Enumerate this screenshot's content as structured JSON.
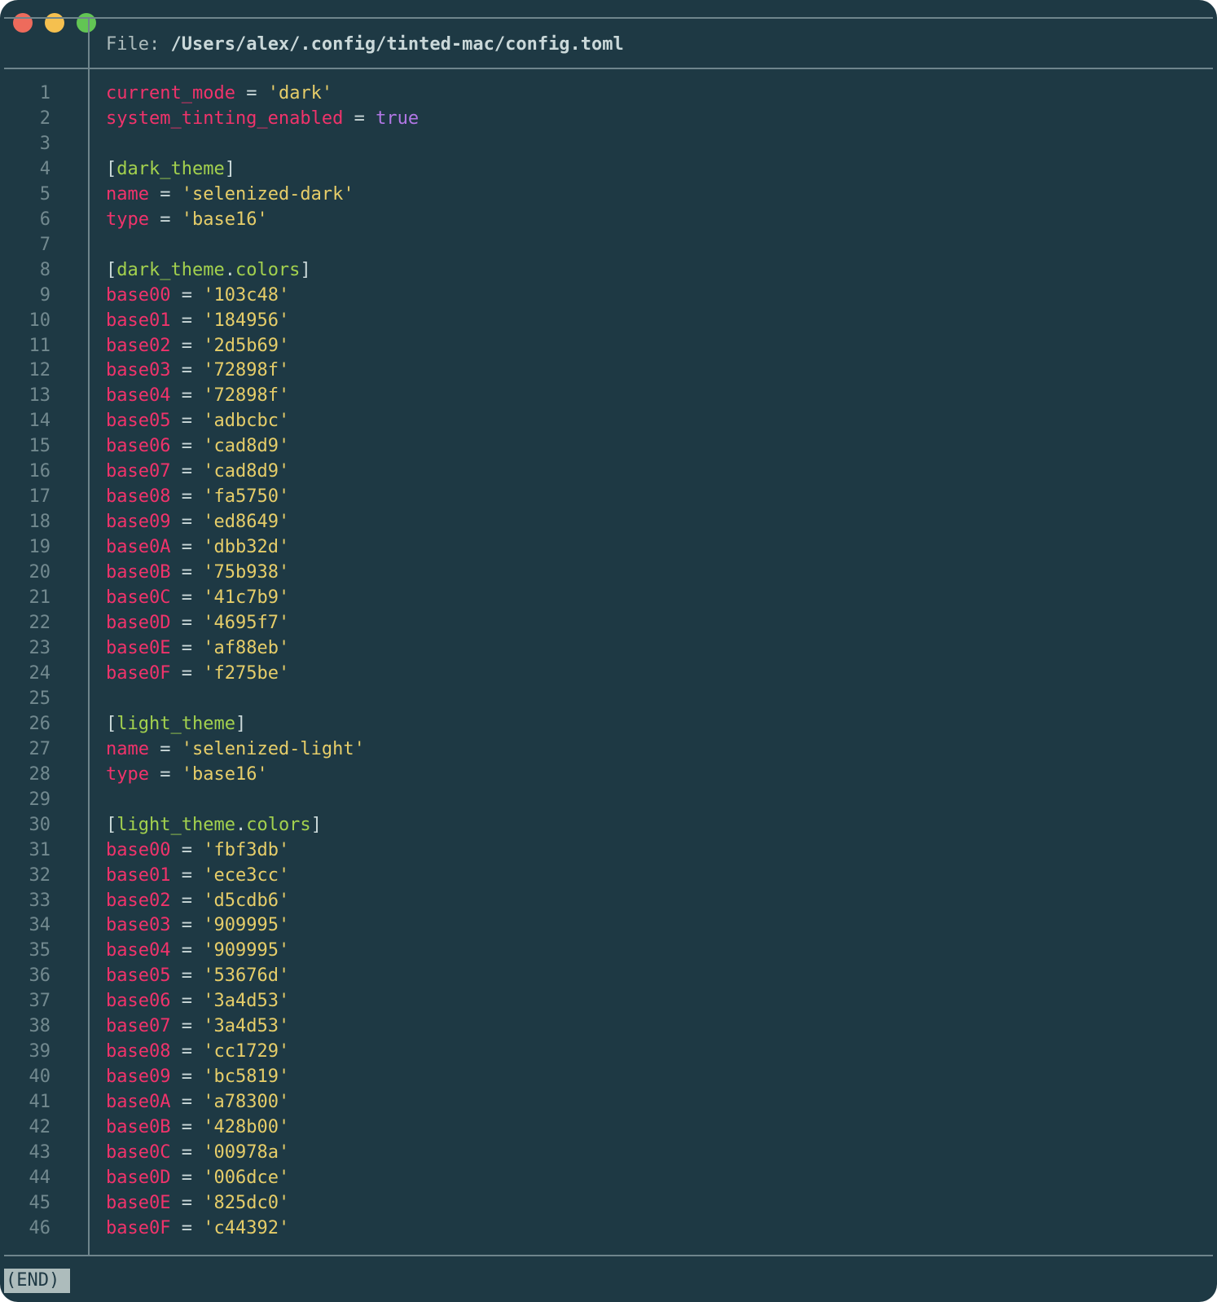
{
  "window": {
    "traffic_lights": [
      {
        "name": "close",
        "color": "#ee6b5c"
      },
      {
        "name": "minimize",
        "color": "#f5c04f"
      },
      {
        "name": "maximize",
        "color": "#62c554"
      }
    ]
  },
  "header": {
    "label": "File: ",
    "path": "/Users/alex/.config/tinted-mac/config.toml"
  },
  "colors": {
    "background": "#1e3944",
    "key": "#f0336b",
    "string": "#e6cd69",
    "table_name": "#a3d14e",
    "boolean": "#b277e6",
    "line_number": "#72898f",
    "rule": "#6f858c"
  },
  "lines": [
    {
      "n": "1",
      "kind": "kv",
      "key": "current_mode",
      "value": "'dark'"
    },
    {
      "n": "2",
      "kind": "kvbool",
      "key": "system_tinting_enabled",
      "value": "true"
    },
    {
      "n": "3",
      "kind": "blank"
    },
    {
      "n": "4",
      "kind": "table",
      "parts": [
        "dark_theme"
      ]
    },
    {
      "n": "5",
      "kind": "kv",
      "key": "name",
      "value": "'selenized-dark'"
    },
    {
      "n": "6",
      "kind": "kv",
      "key": "type",
      "value": "'base16'"
    },
    {
      "n": "7",
      "kind": "blank"
    },
    {
      "n": "8",
      "kind": "table",
      "parts": [
        "dark_theme",
        "colors"
      ]
    },
    {
      "n": "9",
      "kind": "kv",
      "key": "base00",
      "value": "'103c48'"
    },
    {
      "n": "10",
      "kind": "kv",
      "key": "base01",
      "value": "'184956'"
    },
    {
      "n": "11",
      "kind": "kv",
      "key": "base02",
      "value": "'2d5b69'"
    },
    {
      "n": "12",
      "kind": "kv",
      "key": "base03",
      "value": "'72898f'"
    },
    {
      "n": "13",
      "kind": "kv",
      "key": "base04",
      "value": "'72898f'"
    },
    {
      "n": "14",
      "kind": "kv",
      "key": "base05",
      "value": "'adbcbc'"
    },
    {
      "n": "15",
      "kind": "kv",
      "key": "base06",
      "value": "'cad8d9'"
    },
    {
      "n": "16",
      "kind": "kv",
      "key": "base07",
      "value": "'cad8d9'"
    },
    {
      "n": "17",
      "kind": "kv",
      "key": "base08",
      "value": "'fa5750'"
    },
    {
      "n": "18",
      "kind": "kv",
      "key": "base09",
      "value": "'ed8649'"
    },
    {
      "n": "19",
      "kind": "kv",
      "key": "base0A",
      "value": "'dbb32d'"
    },
    {
      "n": "20",
      "kind": "kv",
      "key": "base0B",
      "value": "'75b938'"
    },
    {
      "n": "21",
      "kind": "kv",
      "key": "base0C",
      "value": "'41c7b9'"
    },
    {
      "n": "22",
      "kind": "kv",
      "key": "base0D",
      "value": "'4695f7'"
    },
    {
      "n": "23",
      "kind": "kv",
      "key": "base0E",
      "value": "'af88eb'"
    },
    {
      "n": "24",
      "kind": "kv",
      "key": "base0F",
      "value": "'f275be'"
    },
    {
      "n": "25",
      "kind": "blank"
    },
    {
      "n": "26",
      "kind": "table",
      "parts": [
        "light_theme"
      ]
    },
    {
      "n": "27",
      "kind": "kv",
      "key": "name",
      "value": "'selenized-light'"
    },
    {
      "n": "28",
      "kind": "kv",
      "key": "type",
      "value": "'base16'"
    },
    {
      "n": "29",
      "kind": "blank"
    },
    {
      "n": "30",
      "kind": "table",
      "parts": [
        "light_theme",
        "colors"
      ]
    },
    {
      "n": "31",
      "kind": "kv",
      "key": "base00",
      "value": "'fbf3db'"
    },
    {
      "n": "32",
      "kind": "kv",
      "key": "base01",
      "value": "'ece3cc'"
    },
    {
      "n": "33",
      "kind": "kv",
      "key": "base02",
      "value": "'d5cdb6'"
    },
    {
      "n": "34",
      "kind": "kv",
      "key": "base03",
      "value": "'909995'"
    },
    {
      "n": "35",
      "kind": "kv",
      "key": "base04",
      "value": "'909995'"
    },
    {
      "n": "36",
      "kind": "kv",
      "key": "base05",
      "value": "'53676d'"
    },
    {
      "n": "37",
      "kind": "kv",
      "key": "base06",
      "value": "'3a4d53'"
    },
    {
      "n": "38",
      "kind": "kv",
      "key": "base07",
      "value": "'3a4d53'"
    },
    {
      "n": "39",
      "kind": "kv",
      "key": "base08",
      "value": "'cc1729'"
    },
    {
      "n": "40",
      "kind": "kv",
      "key": "base09",
      "value": "'bc5819'"
    },
    {
      "n": "41",
      "kind": "kv",
      "key": "base0A",
      "value": "'a78300'"
    },
    {
      "n": "42",
      "kind": "kv",
      "key": "base0B",
      "value": "'428b00'"
    },
    {
      "n": "43",
      "kind": "kv",
      "key": "base0C",
      "value": "'00978a'"
    },
    {
      "n": "44",
      "kind": "kv",
      "key": "base0D",
      "value": "'006dce'"
    },
    {
      "n": "45",
      "kind": "kv",
      "key": "base0E",
      "value": "'825dc0'"
    },
    {
      "n": "46",
      "kind": "kv",
      "key": "base0F",
      "value": "'c44392'"
    }
  ],
  "status": {
    "text": "(END)"
  }
}
